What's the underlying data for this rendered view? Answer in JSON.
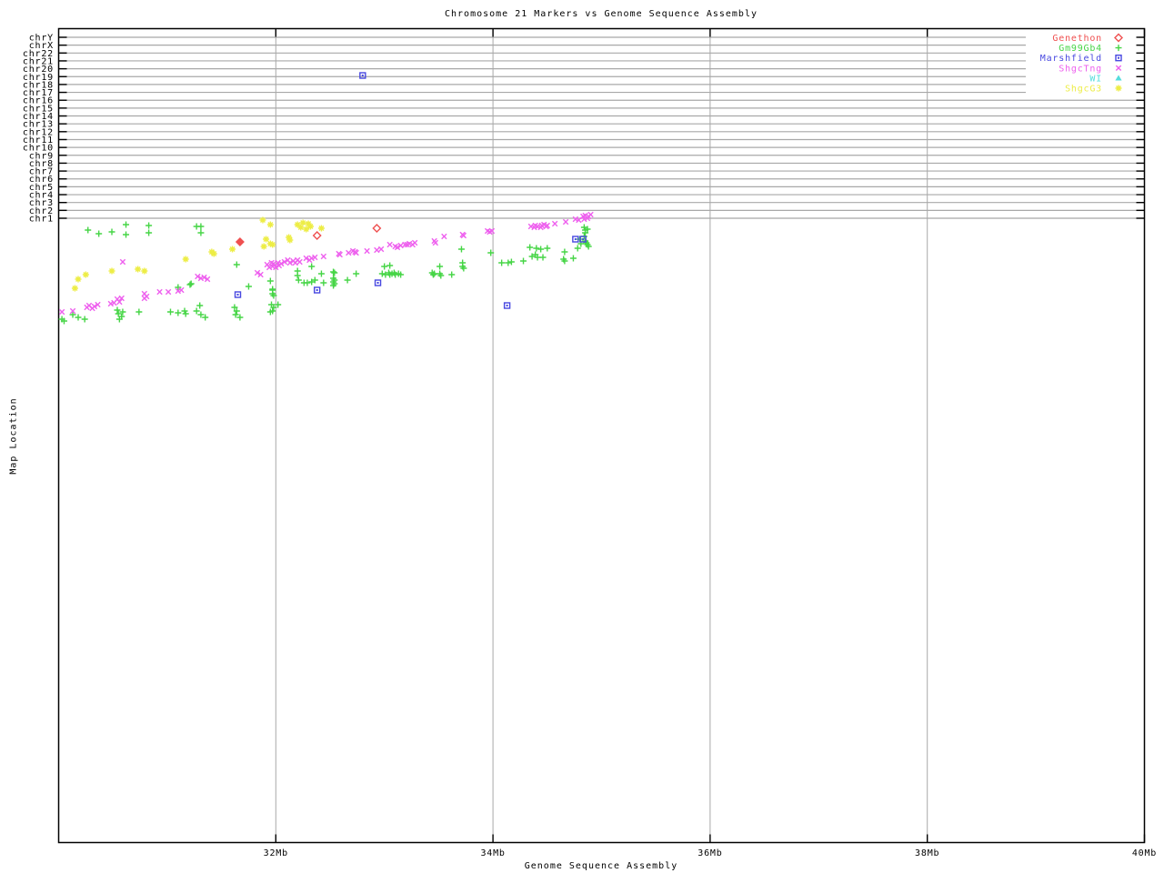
{
  "title": "Chromosome 21 Markers vs Genome Sequence Assembly",
  "x_axis": {
    "label": "Genome Sequence Assembly",
    "tick_labels": [
      "32Mb",
      "34Mb",
      "36Mb",
      "38Mb",
      "40Mb"
    ],
    "tick_values_mb": [
      32,
      34,
      36,
      38,
      40
    ],
    "range_mb": [
      30,
      40
    ]
  },
  "y_axis": {
    "label": "Map Location",
    "tick_labels": [
      "chrY",
      "chrX",
      "chr22",
      "chr21",
      "chr20",
      "chr19",
      "chr18",
      "chr17",
      "chr16",
      "chr15",
      "chr14",
      "chr13",
      "chr12",
      "chr11",
      "chr10",
      "chr9",
      "chr8",
      "chr7",
      "chr6",
      "chr5",
      "chr4",
      "chr3",
      "chr2",
      "chr1"
    ]
  },
  "colors": {
    "grid": "#a8a8a8",
    "border": "#000000",
    "genethon_red": "#ef5050",
    "gm99gb4_green": "#46d546",
    "marshfield_blue": "#4848e0",
    "shgctng_magenta": "#ee60ee",
    "wi_cyan": "#55dddd",
    "shgcg3_yellow": "#eded45"
  },
  "chart_data": {
    "type": "scatter",
    "title": "Chromosome 21 Markers vs Genome Sequence Assembly",
    "xlabel": "Genome Sequence Assembly",
    "ylabel": "Map Location",
    "x_unit": "Mb",
    "x_range": [
      30,
      40
    ],
    "grid": true,
    "legend_position": "top-right",
    "y_note": "Map Location axis shows chromosome bands chrY..chr1 (no numeric scale); point y given as vertical screen position px; one Marshfield marker sits on the chr19 band, all other markers lie in the map band below chr1",
    "series": [
      {
        "name": "Genethon",
        "color": "#ef5050",
        "marker": "diamond",
        "points": [
          [
            31.67,
            266,
            "filled"
          ],
          [
            32.38,
            259
          ],
          [
            32.93,
            251
          ]
        ]
      },
      {
        "name": "Gm99Gb4",
        "color": "#46d546",
        "marker": "plus",
        "points": [
          [
            30.27,
            253
          ],
          [
            30.37,
            257
          ],
          [
            30.49,
            255
          ],
          [
            30.62,
            247
          ],
          [
            30.62,
            258
          ],
          [
            30.83,
            248
          ],
          [
            30.83,
            256
          ],
          [
            31.27,
            249
          ],
          [
            31.31,
            249
          ],
          [
            31.31,
            256
          ],
          [
            31.1,
            316
          ],
          [
            31.21,
            313
          ],
          [
            31.22,
            312
          ],
          [
            30.03,
            351
          ],
          [
            30.05,
            353
          ],
          [
            30.13,
            346
          ],
          [
            30.18,
            349
          ],
          [
            30.24,
            351
          ],
          [
            30.54,
            341
          ],
          [
            30.55,
            345
          ],
          [
            30.58,
            348
          ],
          [
            30.56,
            351
          ],
          [
            30.59,
            343
          ],
          [
            30.74,
            343
          ],
          [
            31.03,
            343
          ],
          [
            31.1,
            344
          ],
          [
            31.16,
            342
          ],
          [
            31.17,
            345
          ],
          [
            31.3,
            336
          ],
          [
            31.27,
            342
          ],
          [
            31.31,
            346
          ],
          [
            31.35,
            349
          ],
          [
            31.62,
            338
          ],
          [
            31.64,
            342
          ],
          [
            31.63,
            346
          ],
          [
            31.67,
            349
          ],
          [
            31.75,
            315
          ],
          [
            31.64,
            291
          ],
          [
            31.95,
            309
          ],
          [
            31.97,
            318
          ],
          [
            31.97,
            319
          ],
          [
            31.97,
            323
          ],
          [
            31.98,
            325
          ],
          [
            31.96,
            335
          ],
          [
            31.98,
            338
          ],
          [
            32.02,
            335
          ],
          [
            31.97,
            342
          ],
          [
            31.95,
            343
          ],
          [
            32.2,
            298
          ],
          [
            32.2,
            303
          ],
          [
            32.21,
            308
          ],
          [
            32.26,
            311
          ],
          [
            32.29,
            311
          ],
          [
            32.33,
            310
          ],
          [
            32.36,
            308
          ],
          [
            32.42,
            301
          ],
          [
            32.44,
            311
          ],
          [
            32.33,
            293
          ],
          [
            32.53,
            299
          ],
          [
            32.54,
            300
          ],
          [
            32.53,
            306
          ],
          [
            32.54,
            308
          ],
          [
            32.53,
            310
          ],
          [
            32.54,
            312
          ],
          [
            32.53,
            314
          ],
          [
            32.66,
            308
          ],
          [
            32.74,
            301
          ],
          [
            33.0,
            293
          ],
          [
            33.05,
            292
          ],
          [
            32.98,
            301
          ],
          [
            33.01,
            302
          ],
          [
            33.04,
            300
          ],
          [
            33.05,
            302
          ],
          [
            33.07,
            301
          ],
          [
            33.09,
            300
          ],
          [
            33.1,
            302
          ],
          [
            33.13,
            301
          ],
          [
            33.15,
            302
          ],
          [
            33.44,
            300
          ],
          [
            33.45,
            302
          ],
          [
            33.46,
            301
          ],
          [
            33.51,
            293
          ],
          [
            33.51,
            301
          ],
          [
            33.52,
            303
          ],
          [
            33.62,
            302
          ],
          [
            33.71,
            274
          ],
          [
            33.72,
            289
          ],
          [
            33.72,
            293
          ],
          [
            33.73,
            295
          ],
          [
            33.98,
            278
          ],
          [
            34.08,
            289
          ],
          [
            34.14,
            289
          ],
          [
            34.17,
            288
          ],
          [
            34.28,
            287
          ],
          [
            34.34,
            272
          ],
          [
            34.4,
            273
          ],
          [
            34.36,
            282
          ],
          [
            34.39,
            280
          ],
          [
            34.41,
            283
          ],
          [
            34.44,
            274
          ],
          [
            34.46,
            283
          ],
          [
            34.5,
            273
          ],
          [
            34.66,
            277
          ],
          [
            34.66,
            287
          ],
          [
            34.65,
            285
          ],
          [
            34.74,
            284
          ],
          [
            34.78,
            273
          ],
          [
            34.8,
            263
          ],
          [
            34.81,
            268
          ],
          [
            34.84,
            250
          ],
          [
            34.87,
            252
          ],
          [
            34.85,
            256
          ],
          [
            34.84,
            260
          ],
          [
            34.85,
            265
          ],
          [
            34.86,
            267
          ],
          [
            34.87,
            269
          ],
          [
            34.88,
            271
          ],
          [
            34.85,
            253
          ]
        ]
      },
      {
        "name": "Marshfield",
        "color": "#4848e0",
        "marker": "box-dot",
        "points": [
          [
            32.8,
            83
          ],
          [
            31.65,
            324
          ],
          [
            32.38,
            319
          ],
          [
            32.94,
            311
          ],
          [
            34.13,
            336
          ],
          [
            34.76,
            263
          ],
          [
            34.83,
            263
          ]
        ]
      },
      {
        "name": "ShgcTng",
        "color": "#ee60ee",
        "marker": "cross",
        "points": [
          [
            30.03,
            343
          ],
          [
            30.13,
            342
          ],
          [
            30.26,
            338
          ],
          [
            30.28,
            336
          ],
          [
            30.31,
            339
          ],
          [
            30.33,
            337
          ],
          [
            30.36,
            335
          ],
          [
            30.48,
            334
          ],
          [
            30.51,
            333
          ],
          [
            30.54,
            329
          ],
          [
            30.56,
            332
          ],
          [
            30.58,
            328
          ],
          [
            30.59,
            288
          ],
          [
            30.79,
            328
          ],
          [
            30.79,
            323
          ],
          [
            30.81,
            326
          ],
          [
            30.93,
            321
          ],
          [
            31.01,
            321
          ],
          [
            31.1,
            320
          ],
          [
            31.13,
            319
          ],
          [
            31.28,
            304
          ],
          [
            31.31,
            306
          ],
          [
            31.34,
            305
          ],
          [
            31.37,
            307
          ],
          [
            31.83,
            300
          ],
          [
            31.86,
            302
          ],
          [
            31.92,
            291
          ],
          [
            31.94,
            294
          ],
          [
            31.96,
            289
          ],
          [
            31.97,
            293
          ],
          [
            31.98,
            290
          ],
          [
            32.0,
            294
          ],
          [
            32.02,
            289
          ],
          [
            32.03,
            292
          ],
          [
            32.05,
            290
          ],
          [
            32.08,
            288
          ],
          [
            32.11,
            286
          ],
          [
            32.13,
            289
          ],
          [
            32.16,
            287
          ],
          [
            32.18,
            289
          ],
          [
            32.2,
            286
          ],
          [
            32.22,
            288
          ],
          [
            32.28,
            284
          ],
          [
            32.31,
            286
          ],
          [
            32.33,
            284
          ],
          [
            32.36,
            283
          ],
          [
            32.44,
            282
          ],
          [
            32.58,
            279
          ],
          [
            32.59,
            280
          ],
          [
            32.67,
            278
          ],
          [
            32.71,
            276
          ],
          [
            32.73,
            277
          ],
          [
            32.74,
            278
          ],
          [
            32.84,
            276
          ],
          [
            32.93,
            275
          ],
          [
            32.97,
            274
          ],
          [
            33.05,
            269
          ],
          [
            33.1,
            271
          ],
          [
            33.12,
            272
          ],
          [
            33.15,
            270
          ],
          [
            33.19,
            269
          ],
          [
            33.21,
            269
          ],
          [
            33.23,
            268
          ],
          [
            33.26,
            269
          ],
          [
            33.28,
            267
          ],
          [
            33.46,
            265
          ],
          [
            33.47,
            267
          ],
          [
            33.55,
            260
          ],
          [
            33.72,
            258
          ],
          [
            33.73,
            259
          ],
          [
            33.95,
            254
          ],
          [
            33.97,
            255
          ],
          [
            33.99,
            254
          ],
          [
            34.35,
            249
          ],
          [
            34.38,
            250
          ],
          [
            34.39,
            248
          ],
          [
            34.41,
            249
          ],
          [
            34.44,
            250
          ],
          [
            34.45,
            248
          ],
          [
            34.47,
            247
          ],
          [
            34.49,
            249
          ],
          [
            34.5,
            248
          ],
          [
            34.57,
            246
          ],
          [
            34.67,
            244
          ],
          [
            34.76,
            241
          ],
          [
            34.79,
            242
          ],
          [
            34.83,
            238
          ],
          [
            34.84,
            241
          ],
          [
            34.85,
            237
          ],
          [
            34.87,
            240
          ],
          [
            34.88,
            238
          ],
          [
            34.9,
            236
          ]
        ]
      },
      {
        "name": "WI",
        "color": "#55dddd",
        "marker": "triangle",
        "points": []
      },
      {
        "name": "ShgcG3",
        "color": "#eded45",
        "marker": "star",
        "points": [
          [
            30.15,
            317
          ],
          [
            30.18,
            307
          ],
          [
            30.25,
            302
          ],
          [
            30.49,
            298
          ],
          [
            30.73,
            296
          ],
          [
            30.79,
            298
          ],
          [
            31.17,
            285
          ],
          [
            31.41,
            277
          ],
          [
            31.43,
            279
          ],
          [
            31.6,
            274
          ],
          [
            31.89,
            271
          ],
          [
            31.88,
            242
          ],
          [
            31.95,
            247
          ],
          [
            31.91,
            263
          ],
          [
            31.95,
            268
          ],
          [
            31.97,
            269
          ],
          [
            32.12,
            261
          ],
          [
            32.13,
            264
          ],
          [
            32.2,
            247
          ],
          [
            32.23,
            250
          ],
          [
            32.25,
            245
          ],
          [
            32.28,
            252
          ],
          [
            32.3,
            246
          ],
          [
            32.32,
            249
          ],
          [
            32.42,
            251
          ]
        ]
      }
    ]
  }
}
